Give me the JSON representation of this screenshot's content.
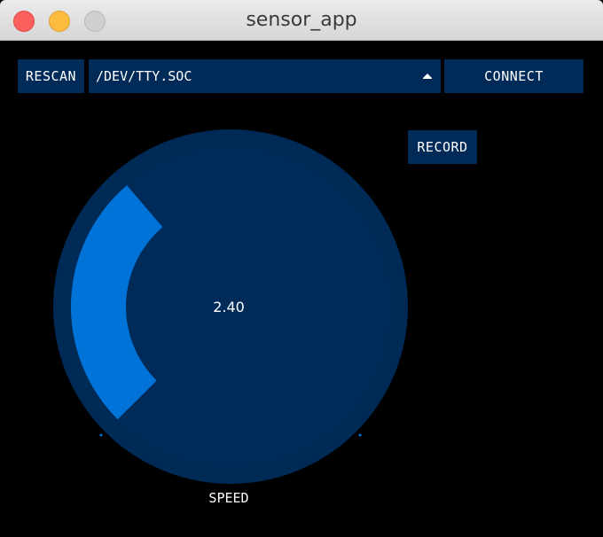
{
  "window": {
    "title": "sensor_app"
  },
  "toolbar": {
    "rescan_label": "RESCAN",
    "port_selected": "/DEV/TTY.SOC",
    "connect_label": "CONNECT"
  },
  "record_label": "RECORD",
  "gauge": {
    "value": "2.40",
    "label": "SPEED",
    "fill_fraction": 0.35
  },
  "colors": {
    "panel": "#002b59",
    "gauge_outer": "#002a56",
    "gauge_inner": "#002b59",
    "gauge_arc": "#0073d9",
    "background": "#000000",
    "text": "#ffffff"
  },
  "icons": {
    "dropdown": "caret-up-icon"
  }
}
